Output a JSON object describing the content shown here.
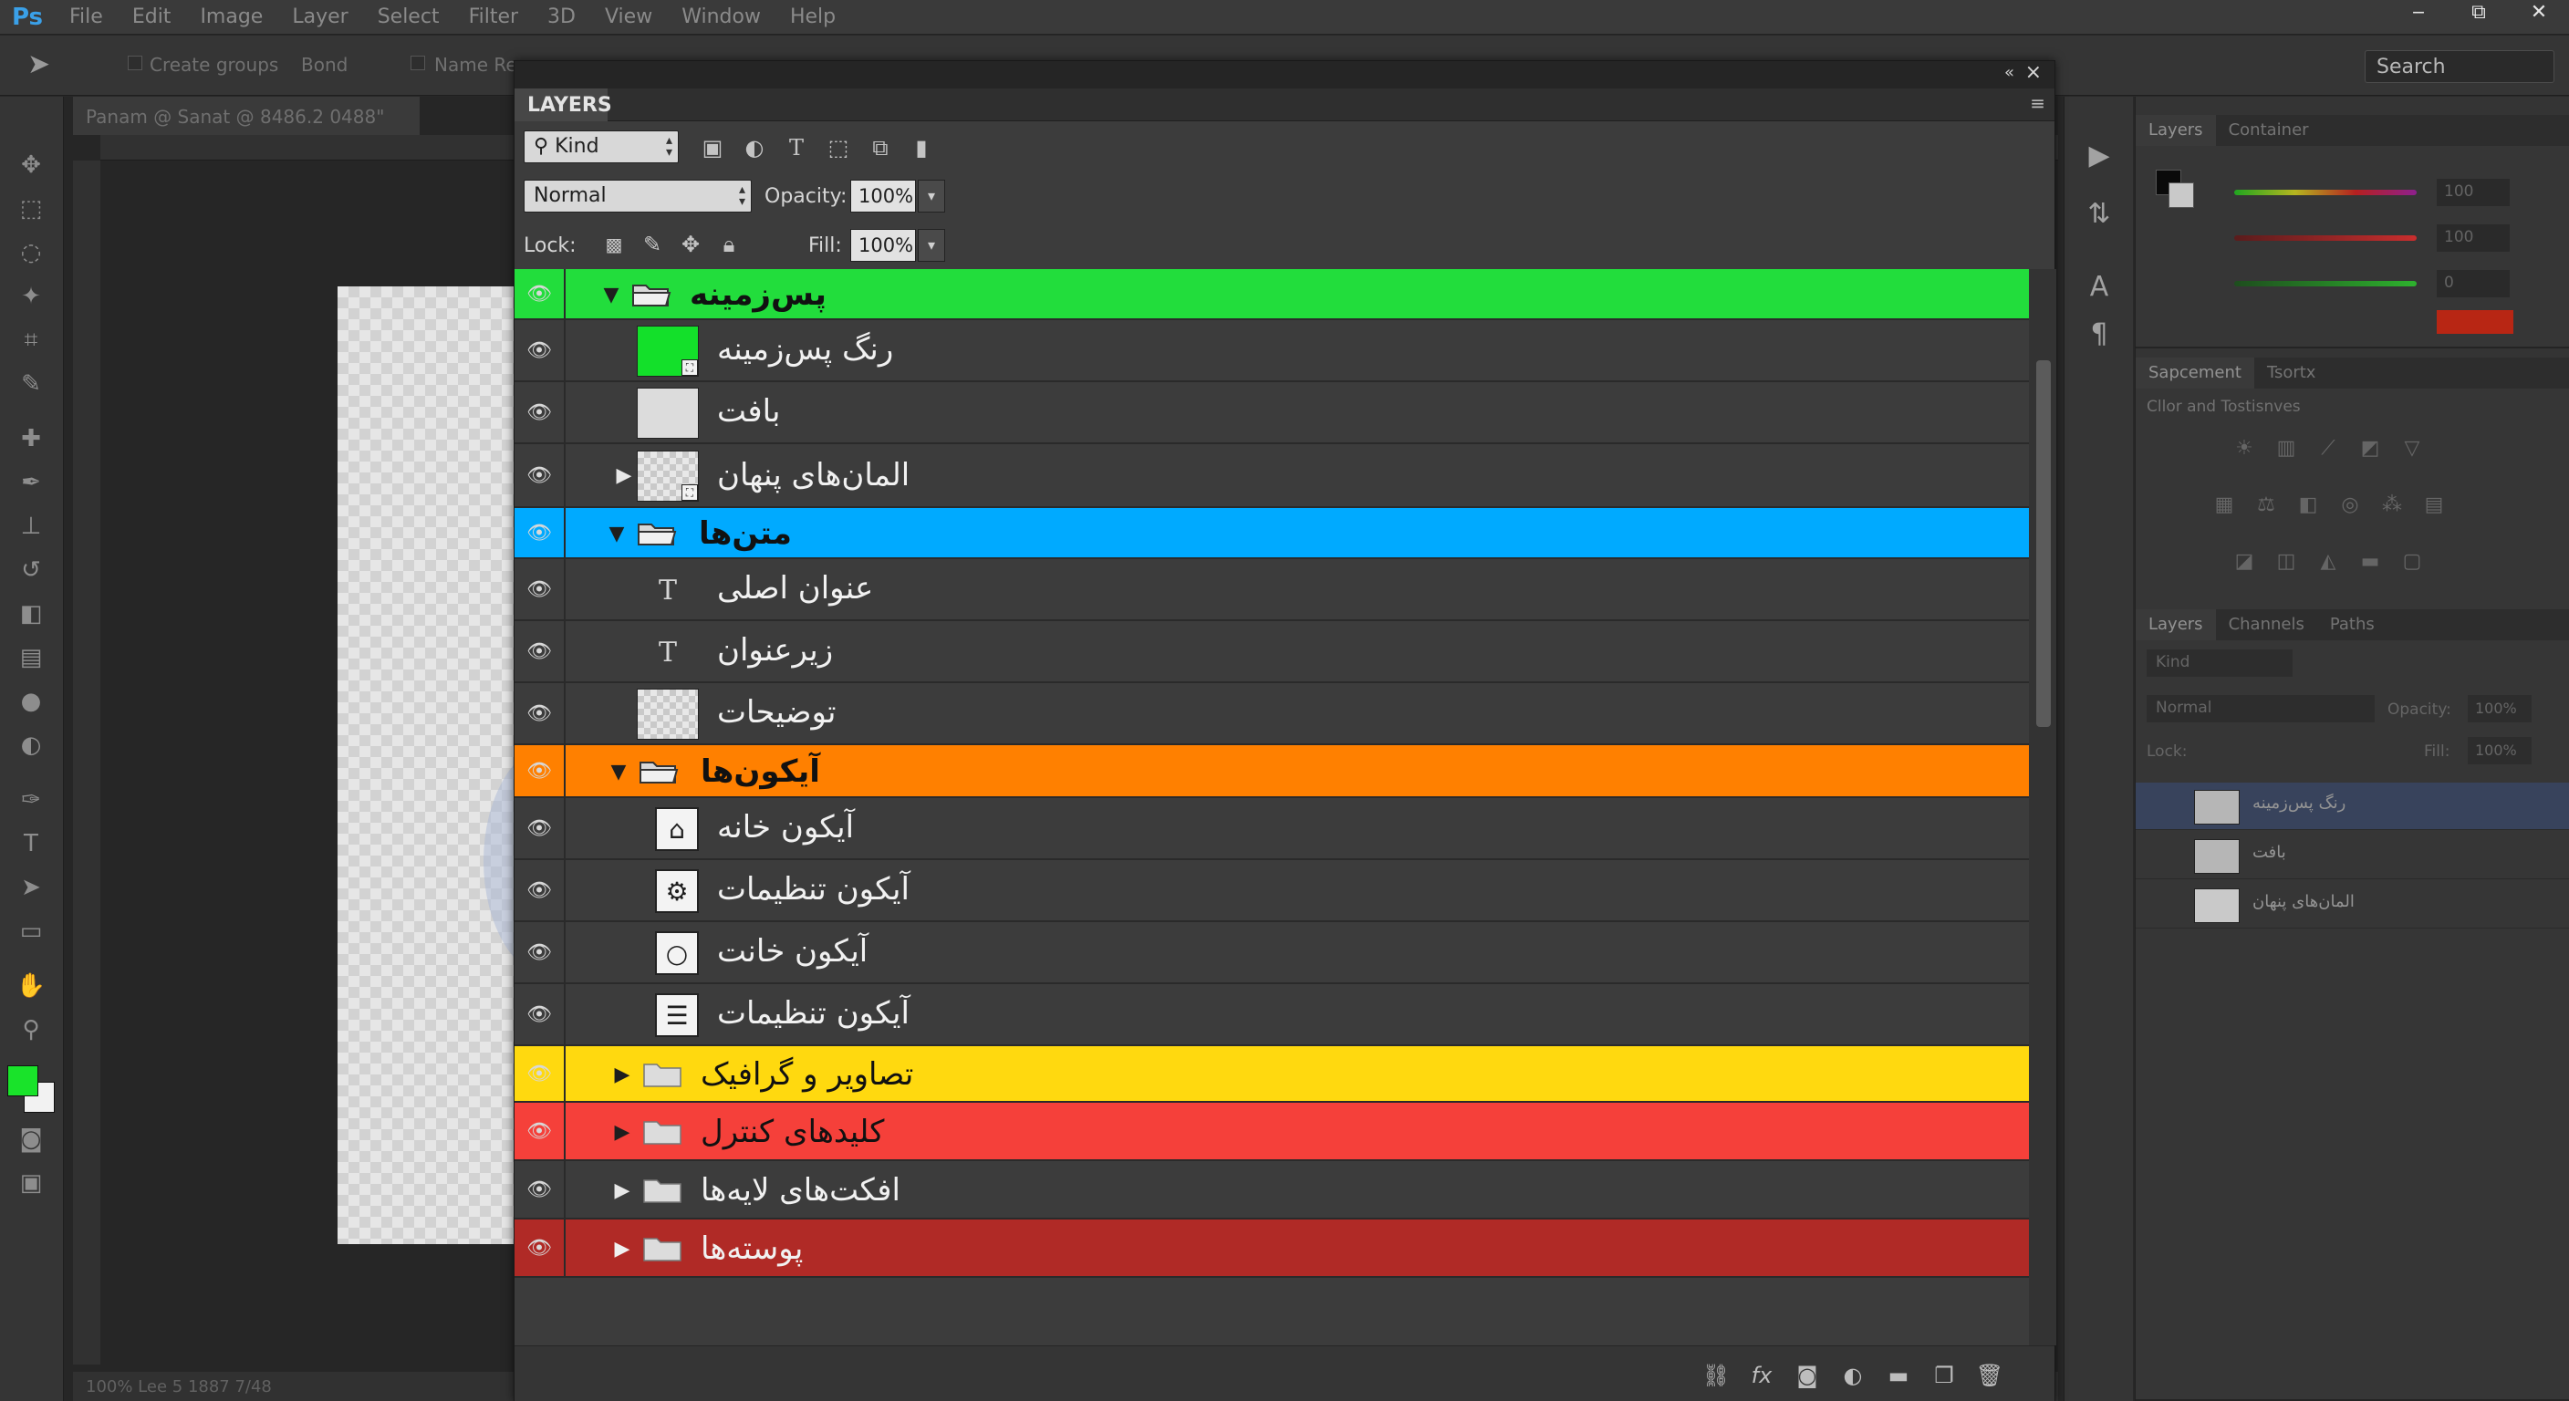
{
  "app": {
    "logo": "Ps",
    "menu": [
      "File",
      "Edit",
      "Image",
      "Layer",
      "Select",
      "Filter",
      "3D",
      "View",
      "Window",
      "Help"
    ],
    "window_controls": [
      "‒",
      "⧉",
      "✕"
    ]
  },
  "options_bar": {
    "create_groups": "Create groups",
    "mode": "Bond",
    "name_label": "Name Re",
    "search_placeholder": "Search"
  },
  "document": {
    "tab_title": "Panam @ Sanat @ 8486.2 0488\"",
    "status": "100%      Lee 5 1887 7/48"
  },
  "layers_panel": {
    "tab_label": "LAYERS",
    "filter_kind": "Kind",
    "blend_mode": "Normal",
    "opacity_label": "Opacity:",
    "opacity_value": "100%",
    "lock_label": "Lock:",
    "fill_label": "Fill:",
    "fill_value": "100%",
    "layers": [
      {
        "name": "پس‌زمینه",
        "type": "group",
        "expanded": true,
        "color": "#22dd3c"
      },
      {
        "name": "رنگ پس‌زمینه",
        "type": "fill",
        "thumb": "green"
      },
      {
        "name": "بافت",
        "type": "pixel",
        "thumb": "plain"
      },
      {
        "name": "المان‌های پنهان",
        "type": "smart",
        "thumb": "transparent",
        "collapsed": true
      },
      {
        "name": "متن‌ها",
        "type": "group",
        "expanded": true,
        "color": "#00aaff"
      },
      {
        "name": "عنوان اصلی",
        "type": "text"
      },
      {
        "name": "زیرعنوان",
        "type": "text"
      },
      {
        "name": "توضیحات",
        "type": "pixel",
        "thumb": "transparent"
      },
      {
        "name": "آیکون‌ها",
        "type": "group",
        "expanded": true,
        "color": "#ff8000"
      },
      {
        "name": "آیکون خانه",
        "type": "icon",
        "icon": "home-icon",
        "glyph": "⌂"
      },
      {
        "name": "آیکون تنظیمات",
        "type": "icon",
        "icon": "gear-icon",
        "glyph": "⚙"
      },
      {
        "name": "آیکون خانت",
        "type": "icon",
        "icon": "circle-icon",
        "glyph": "○"
      },
      {
        "name": "آیکون تنظیمات",
        "type": "icon",
        "icon": "sliders-icon",
        "glyph": "☰"
      },
      {
        "name": "تصاویر و گرافیک",
        "type": "group",
        "expanded": false,
        "color": "#ffd90f"
      },
      {
        "name": "کلیدهای کنترل",
        "type": "group",
        "expanded": false,
        "color": "#f5403a"
      },
      {
        "name": "افکت‌های لایه‌ها",
        "type": "group",
        "expanded": false,
        "color": ""
      },
      {
        "name": "پوسته‌ها",
        "type": "group",
        "expanded": false,
        "color": "#b02a26"
      }
    ],
    "footer_icons": [
      "link-icon",
      "fx-icon",
      "mask-icon",
      "adjustment-icon",
      "folder-icon",
      "new-layer-icon",
      "trash-icon"
    ]
  },
  "right_dock": {
    "color_tabs": [
      "Layers",
      "Container"
    ],
    "color_values": [
      "100",
      "100",
      "0"
    ],
    "adjust_tabs": [
      "Sapcement",
      "Tsortx"
    ],
    "adjust_title": "Cllor and Tostisnves",
    "layers_tabs": [
      "Layers",
      "Channels",
      "Paths"
    ],
    "mini_kind": "Kind",
    "mini_blend": "Normal",
    "mini_opacity_label": "Opacity:",
    "mini_opacity": "100%",
    "mini_lock": "Lock:",
    "mini_fill_label": "Fill:",
    "mini_fill": "100%",
    "mini_layers": [
      "رنگ پس‌زمینه",
      "بافت",
      "المان‌های پنهان"
    ]
  },
  "colors": {
    "accent": "#3aa0e8",
    "fg_swatch": "#19e32a",
    "bg_swatch": "#f2f2f2",
    "red_swatch": "#e8260e"
  }
}
